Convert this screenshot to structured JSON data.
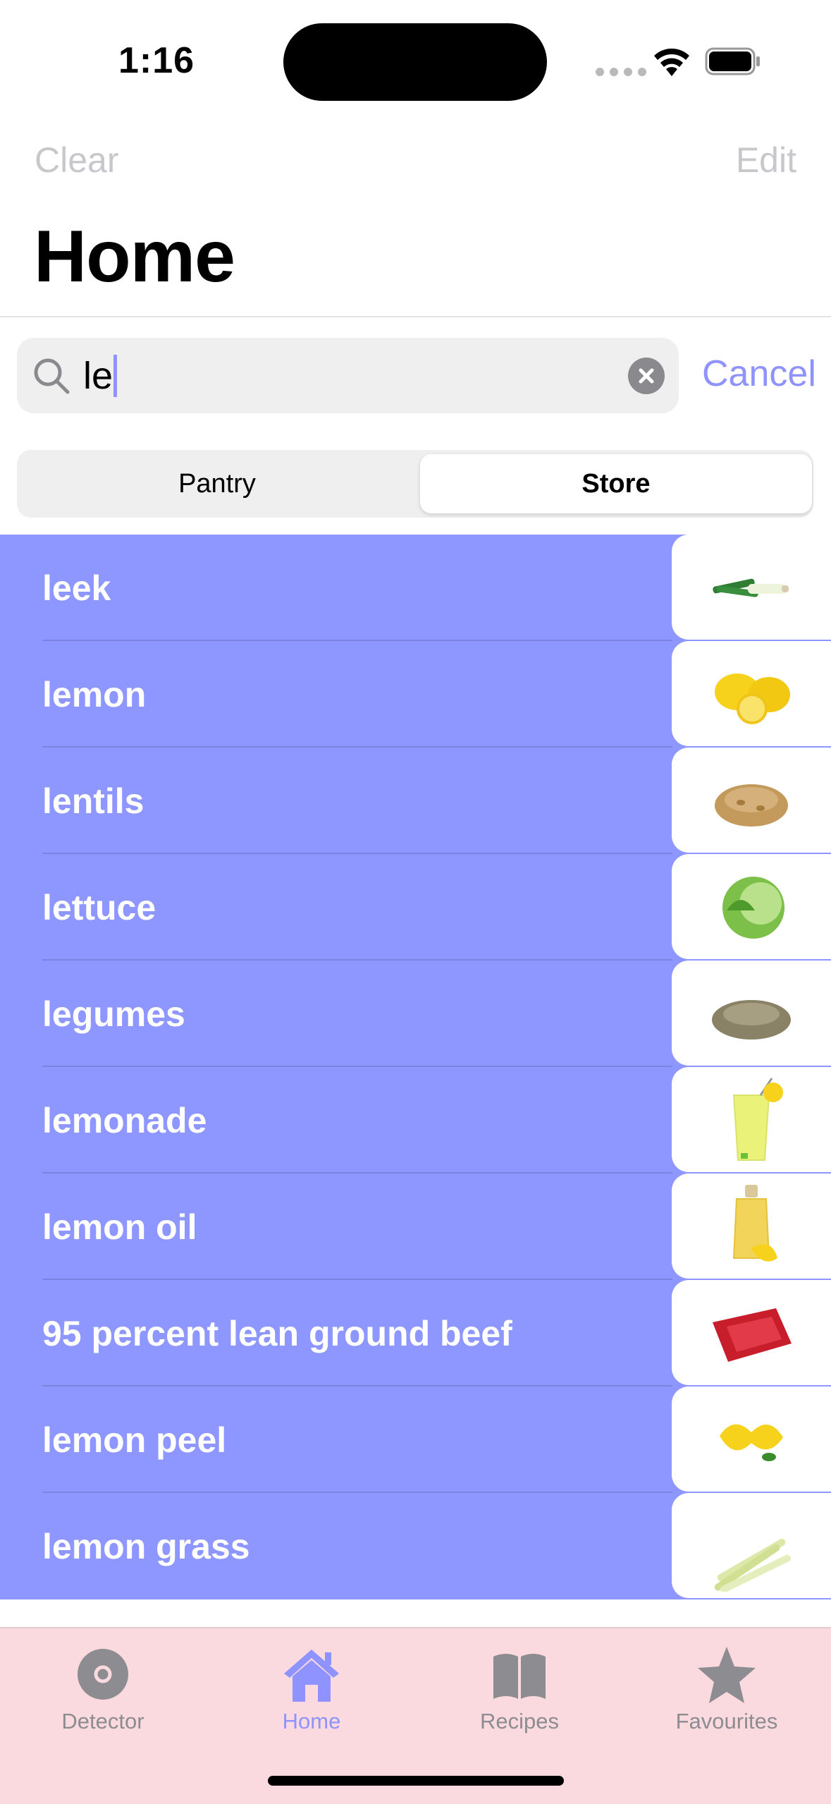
{
  "status_bar": {
    "time": "1:16"
  },
  "nav": {
    "clear_label": "Clear",
    "edit_label": "Edit",
    "title": "Home"
  },
  "search": {
    "value": "le",
    "cancel_label": "Cancel"
  },
  "segments": {
    "pantry_label": "Pantry",
    "store_label": "Store",
    "selected": "Store"
  },
  "results": [
    {
      "label": "leek",
      "image": "leek"
    },
    {
      "label": "lemon",
      "image": "lemon"
    },
    {
      "label": "lentils",
      "image": "lentils"
    },
    {
      "label": "lettuce",
      "image": "lettuce"
    },
    {
      "label": "legumes",
      "image": "legumes"
    },
    {
      "label": "lemonade",
      "image": "lemonade"
    },
    {
      "label": "lemon oil",
      "image": "lemon-oil"
    },
    {
      "label": "95 percent lean ground beef",
      "image": "ground-beef"
    },
    {
      "label": "lemon peel",
      "image": "lemon-peel"
    },
    {
      "label": "lemon grass",
      "image": "lemon-grass"
    }
  ],
  "tabs": [
    {
      "label": "Detector",
      "icon": "disc-icon"
    },
    {
      "label": "Home",
      "icon": "house-icon",
      "active": true
    },
    {
      "label": "Recipes",
      "icon": "book-icon"
    },
    {
      "label": "Favourites",
      "icon": "star-icon"
    }
  ],
  "colors": {
    "accent": "#8e93ff",
    "list_background": "#8e97ff",
    "tabbar_background": "#fadadf"
  }
}
